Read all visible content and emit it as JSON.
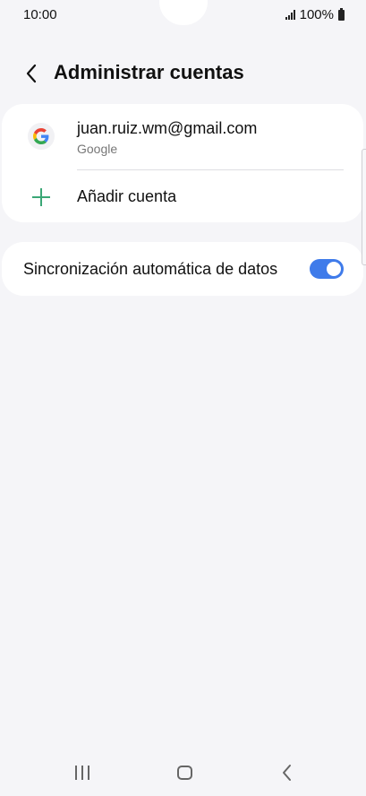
{
  "status_bar": {
    "time": "10:00",
    "battery": "100%",
    "icons": [
      "signal-icon",
      "battery-icon"
    ]
  },
  "header": {
    "title": "Administrar cuentas",
    "back_icon": "chevron-left-icon"
  },
  "accounts": {
    "items": [
      {
        "email": "juan.ruiz.wm@gmail.com",
        "provider": "Google",
        "icon": "google-icon"
      }
    ],
    "add_label": "Añadir cuenta",
    "add_icon": "plus-icon",
    "add_icon_color": "#3ba776"
  },
  "sync": {
    "label": "Sincronización automática de datos",
    "enabled": true,
    "toggle_color": "#3f7bea"
  },
  "nav_bar": {
    "icons": [
      "recent-apps-icon",
      "home-icon",
      "back-icon"
    ]
  }
}
